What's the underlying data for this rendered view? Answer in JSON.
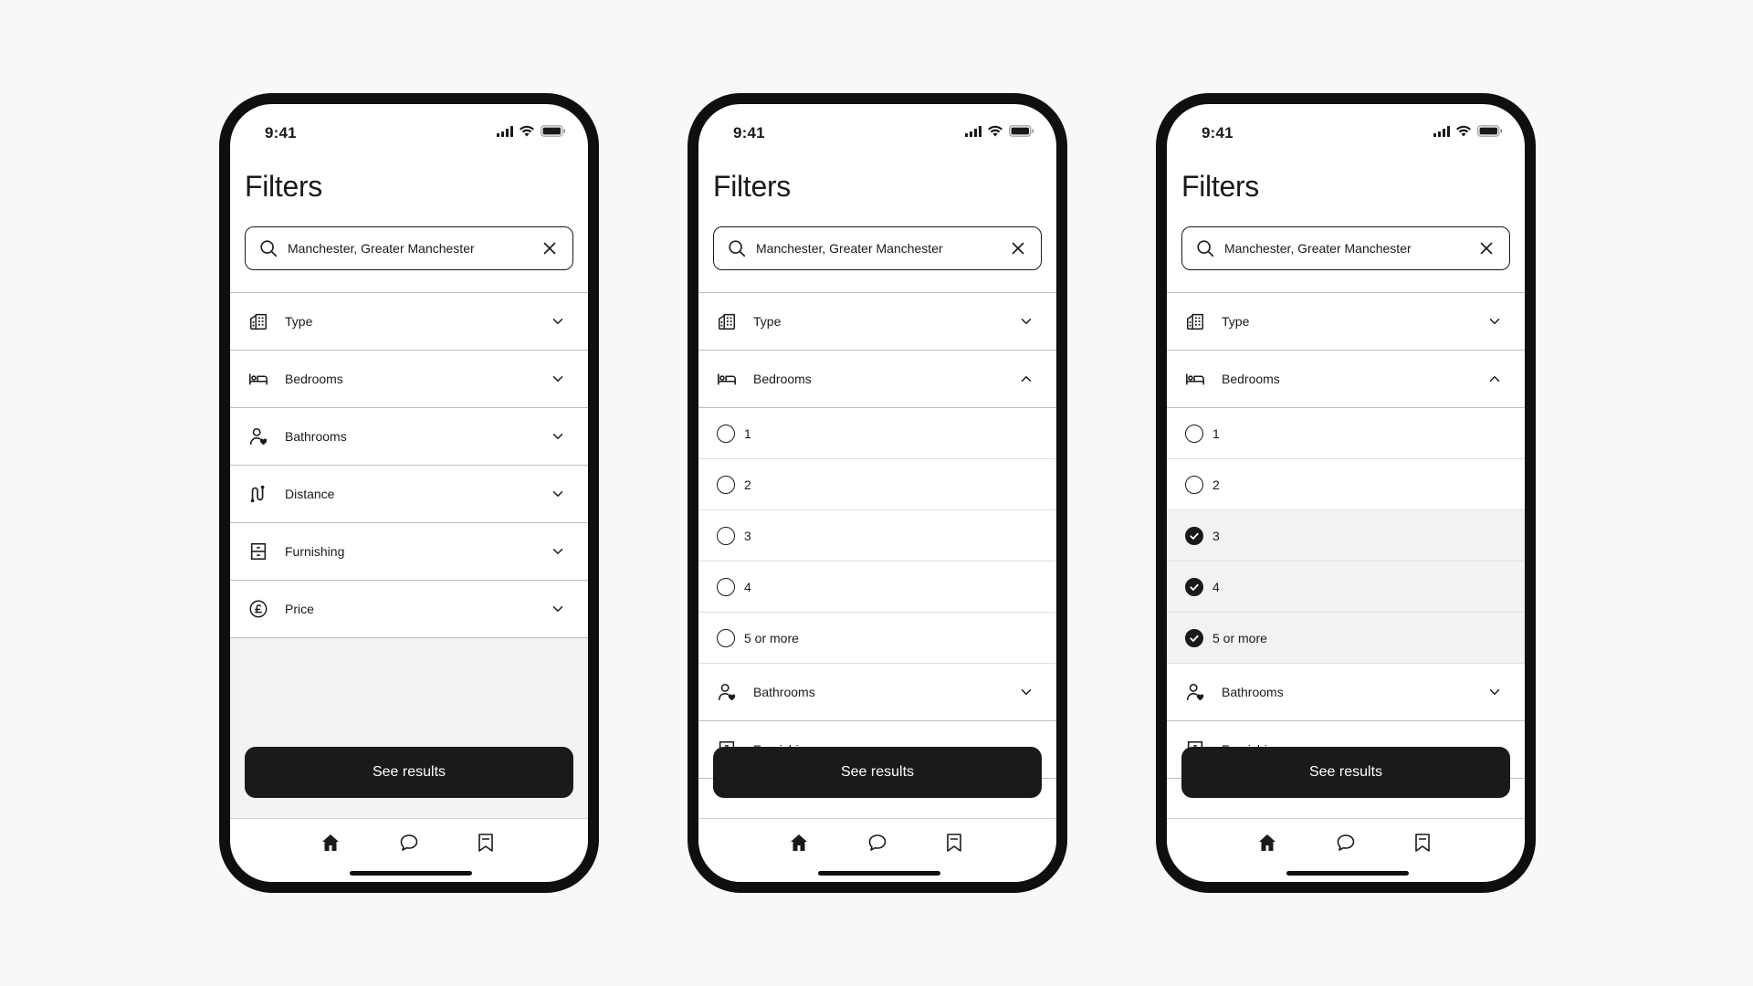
{
  "phones": [
    {
      "status": {
        "time": "9:41"
      },
      "title": "Filters",
      "search": {
        "value": "Manchester, Greater Manchester"
      },
      "filters": [
        {
          "label": "Type"
        },
        {
          "label": "Bedrooms"
        },
        {
          "label": "Bathrooms"
        },
        {
          "label": "Distance"
        },
        {
          "label": "Furnishing"
        },
        {
          "label": "Price"
        }
      ],
      "cta": "See results"
    },
    {
      "status": {
        "time": "9:41"
      },
      "title": "Filters",
      "search": {
        "value": "Manchester, Greater Manchester"
      },
      "filters": [
        {
          "label": "Type"
        },
        {
          "label": "Bedrooms"
        },
        {
          "label": "Bathrooms"
        },
        {
          "label": "Furnishing"
        }
      ],
      "bedroom_options": [
        {
          "label": "1",
          "selected": false
        },
        {
          "label": "2",
          "selected": false
        },
        {
          "label": "3",
          "selected": false
        },
        {
          "label": "4",
          "selected": false
        },
        {
          "label": "5 or more",
          "selected": false
        }
      ],
      "cta": "See results"
    },
    {
      "status": {
        "time": "9:41"
      },
      "title": "Filters",
      "search": {
        "value": "Manchester, Greater Manchester"
      },
      "filters": [
        {
          "label": "Type"
        },
        {
          "label": "Bedrooms"
        },
        {
          "label": "Bathrooms"
        },
        {
          "label": "Furnishing"
        }
      ],
      "bedroom_options": [
        {
          "label": "1",
          "selected": false
        },
        {
          "label": "2",
          "selected": false
        },
        {
          "label": "3",
          "selected": true
        },
        {
          "label": "4",
          "selected": true
        },
        {
          "label": "5 or more",
          "selected": true
        }
      ],
      "cta": "See results"
    }
  ],
  "icons": {
    "search": "search-icon",
    "clear": "close-icon",
    "type": "building-icon",
    "bedrooms": "bed-icon",
    "bathrooms": "person-heart-icon",
    "distance": "route-icon",
    "furnishing": "cabinet-icon",
    "price": "pound-icon",
    "tabs": [
      "home-icon",
      "chat-icon",
      "bookmark-icon"
    ]
  },
  "colors": {
    "ink": "#1a1a1a",
    "background": "#f8f8f8",
    "divider": "#bdbdbd",
    "selected_row": "#f2f2f2"
  }
}
